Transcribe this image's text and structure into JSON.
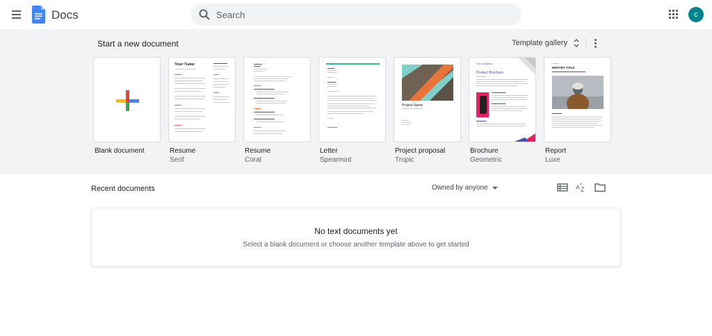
{
  "header": {
    "app_title": "Docs",
    "search_placeholder": "Search",
    "avatar_letter": "c",
    "avatar_color": "#00838f"
  },
  "templates": {
    "start_label": "Start a new document",
    "gallery_label": "Template gallery",
    "items": [
      {
        "name": "Blank document",
        "sub": ""
      },
      {
        "name": "Resume",
        "sub": "Serif",
        "preview_heading": "Your Name"
      },
      {
        "name": "Resume",
        "sub": "Coral"
      },
      {
        "name": "Letter",
        "sub": "Spearmint"
      },
      {
        "name": "Project proposal",
        "sub": "Tropic",
        "preview_heading": "Project Name"
      },
      {
        "name": "Brochure",
        "sub": "Geometric",
        "preview_heading": "Product Brochure",
        "preview_company": "Your Company"
      },
      {
        "name": "Report",
        "sub": "Luxe",
        "preview_heading": "REPORT TITLE"
      }
    ]
  },
  "recent": {
    "label": "Recent documents",
    "owner_filter": "Owned by anyone",
    "empty_title": "No text documents yet",
    "empty_subtitle": "Select a blank document or choose another template above to get started"
  },
  "colors": {
    "google_blue": "#4285f4",
    "google_red": "#ea4335",
    "google_yellow": "#fbbc04",
    "google_green": "#34a853",
    "spearmint": "#2bbf8a",
    "tropic_teal": "#7fd1c8",
    "tropic_orange": "#e8743b",
    "geometric_pink": "#e91e63"
  }
}
